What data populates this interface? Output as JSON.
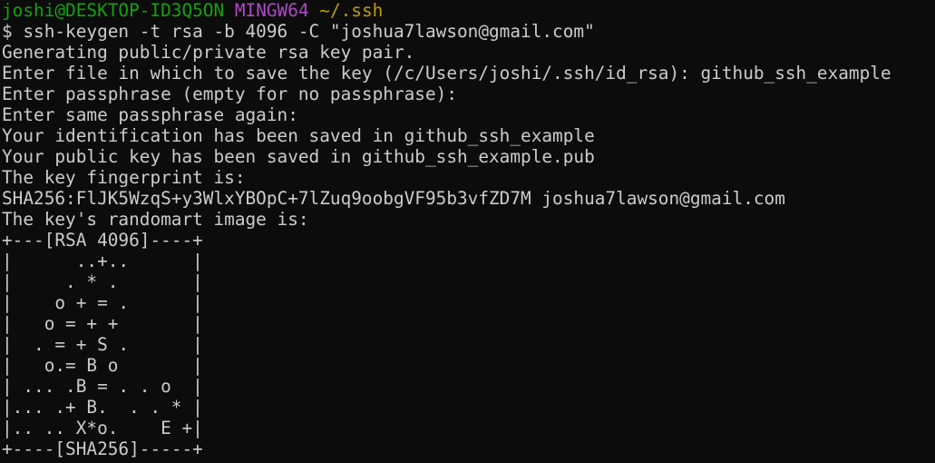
{
  "colors": {
    "background": "#0c0c0c",
    "text": "#cccccc",
    "prompt_user": "#13a10e",
    "prompt_system": "#b148c6",
    "prompt_path": "#c19c00"
  },
  "prompt": {
    "user_host": "joshi@DESKTOP-ID3Q5ON",
    "system": "MINGW64",
    "path": "~/.ssh"
  },
  "command": "$ ssh-keygen -t rsa -b 4096 -C \"joshua7lawson@gmail.com\"",
  "output": [
    "Generating public/private rsa key pair.",
    "Enter file in which to save the key (/c/Users/joshi/.ssh/id_rsa): github_ssh_example",
    "Enter passphrase (empty for no passphrase):",
    "Enter same passphrase again:",
    "Your identification has been saved in github_ssh_example",
    "Your public key has been saved in github_ssh_example.pub",
    "The key fingerprint is:",
    "SHA256:FlJK5WzqS+y3WlxYBOpC+7lZuq9oobgVF95b3vfZD7M joshua7lawson@gmail.com",
    "The key's randomart image is:"
  ],
  "randomart": [
    "+---[RSA 4096]----+",
    "|      ..+..      |",
    "|     . * .       |",
    "|    o + = .      |",
    "|   o = + +       |",
    "|  . = + S .      |",
    "|   o.= B o       |",
    "| ... .B = . . o  |",
    "|... .+ B.  . . * |",
    "|.. .. X*o.    E +|",
    "+----[SHA256]-----+"
  ]
}
